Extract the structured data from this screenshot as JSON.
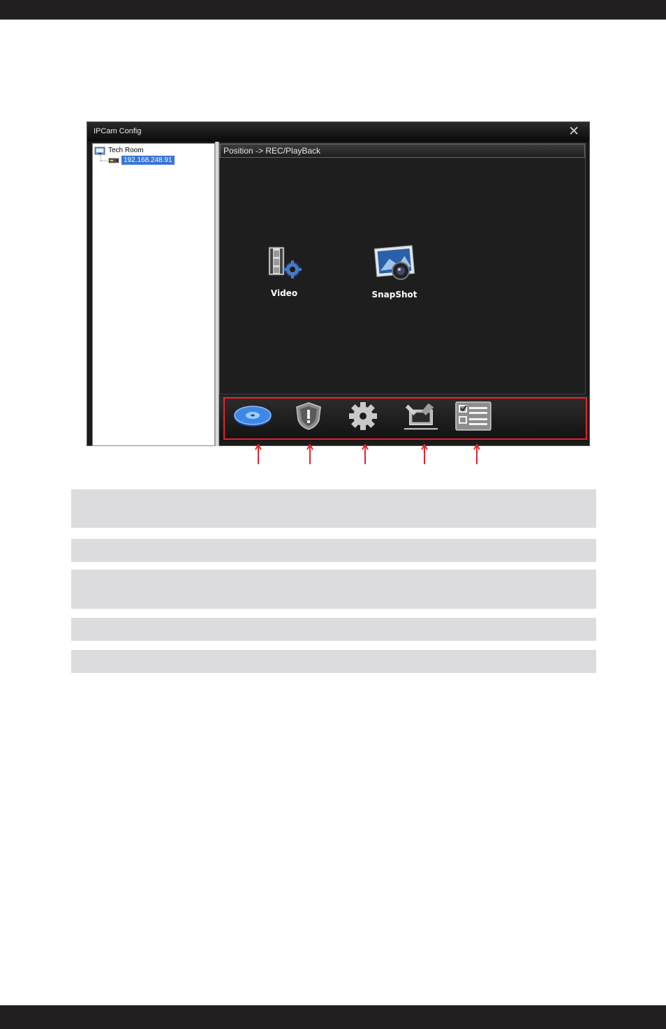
{
  "window": {
    "title": "IPCam Config",
    "close_glyph": "✕"
  },
  "tree": {
    "root_label": "Tech Room",
    "root_icon": "network-folder-icon",
    "child_label": "192.168.248.91",
    "child_icon": "camera-device-icon"
  },
  "breadcrumb": "Position -> REC/PlayBack",
  "tiles": [
    {
      "label": "Video",
      "icon": "video-settings-icon"
    },
    {
      "label": "SnapShot",
      "icon": "snapshot-camera-icon"
    }
  ],
  "toolbar": [
    {
      "icon": "playback-disk-icon"
    },
    {
      "icon": "alarm-shield-icon"
    },
    {
      "icon": "settings-gear-icon"
    },
    {
      "icon": "network-tools-icon"
    },
    {
      "icon": "system-checklist-icon"
    }
  ],
  "colors": {
    "accent_red": "#e8232a",
    "selection_blue": "#3a74d6",
    "page_bar": "#231f20",
    "description_row": "#dcdcdf"
  }
}
